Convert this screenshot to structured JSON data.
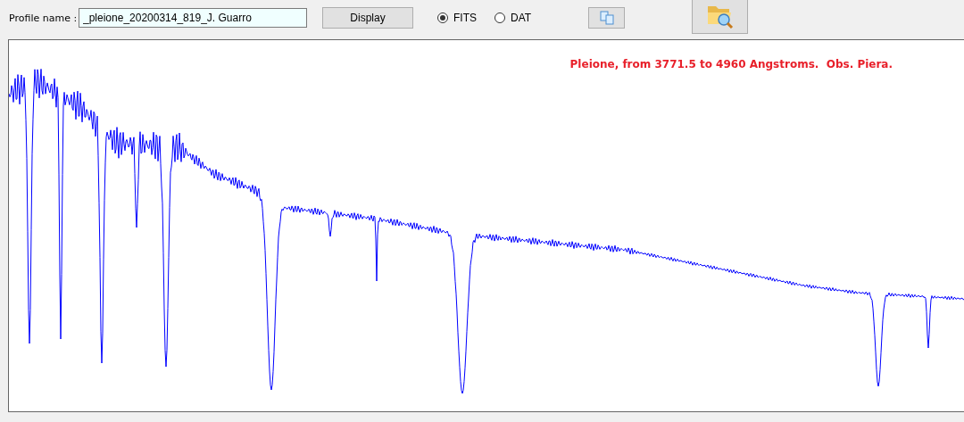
{
  "profile_name": {
    "label": "Profile name :",
    "value": "_pleione_20200314_819_J. Guarro"
  },
  "display_button": "Display",
  "formats": [
    {
      "label": "FITS",
      "selected": true
    },
    {
      "label": "DAT",
      "selected": false
    }
  ],
  "plot": {
    "caption": "Pleione, from 3771.5 to 4960 Angstroms.  Obs. Piera."
  }
}
